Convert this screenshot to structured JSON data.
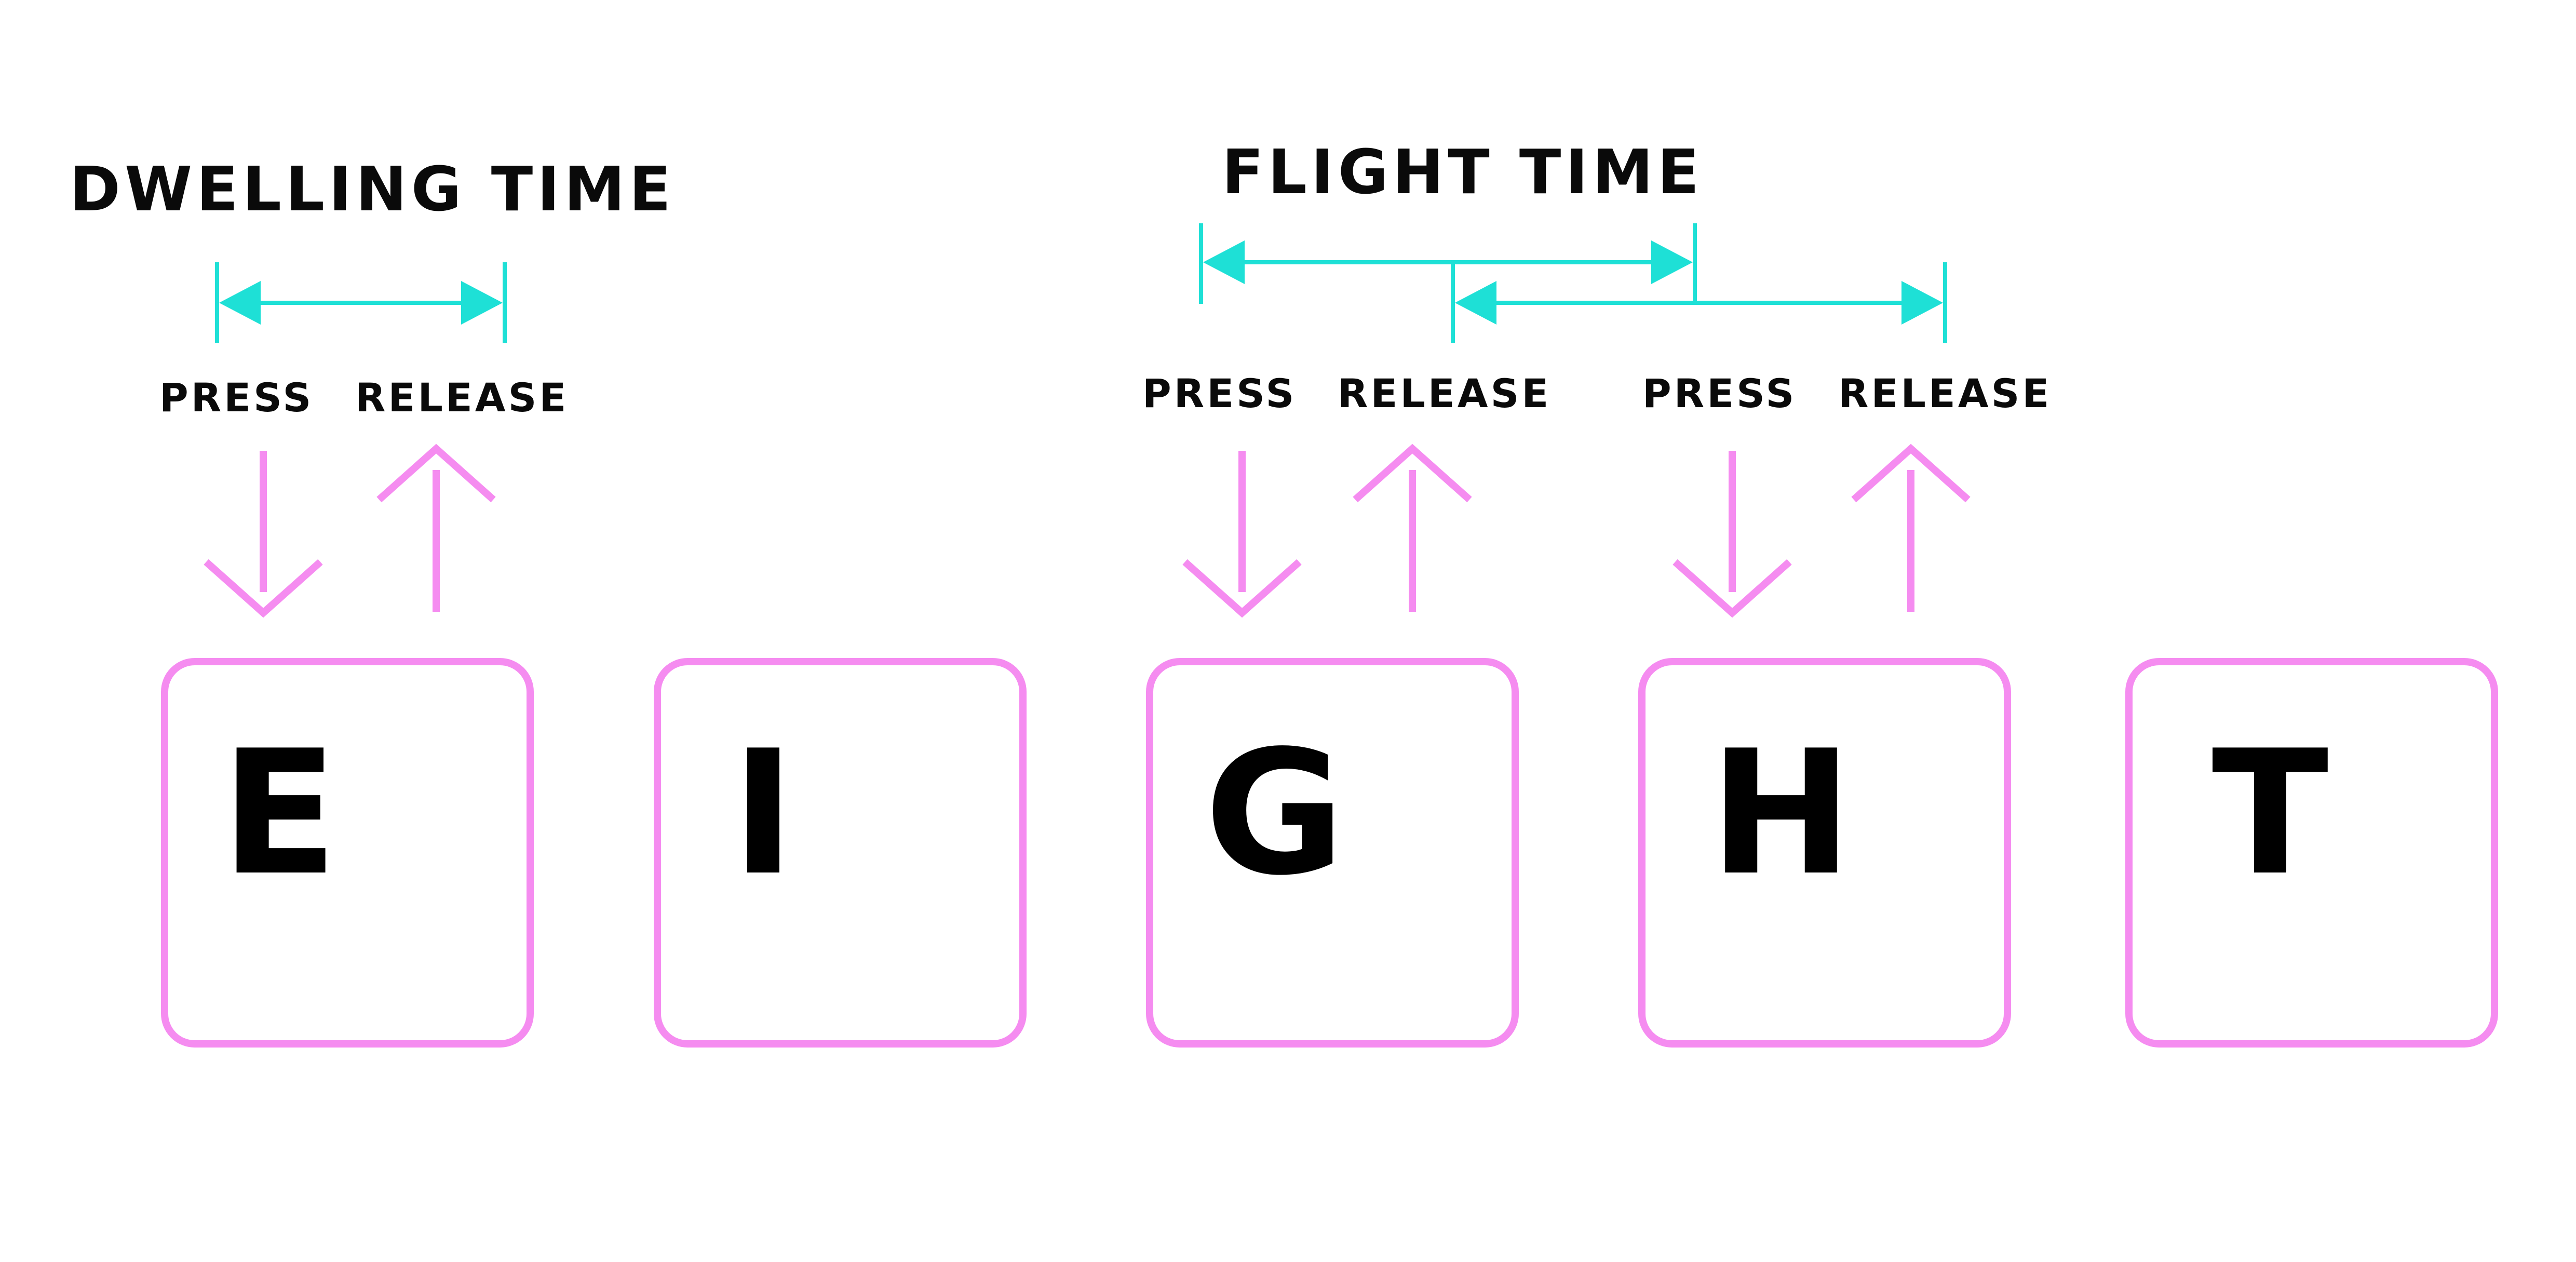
{
  "colors": {
    "key_outline": "#f58cf0",
    "press_release_arrow": "#f58cf0",
    "timing_bracket": "#1ee0d6",
    "text": "#0a0a0a",
    "background": "#ffffff"
  },
  "titles": {
    "dwelling": "DWELLING TIME",
    "flight": "FLIGHT TIME"
  },
  "labels": {
    "press": "PRESS",
    "release": "RELEASE"
  },
  "keys": [
    "E",
    "I",
    "G",
    "H",
    "T"
  ]
}
